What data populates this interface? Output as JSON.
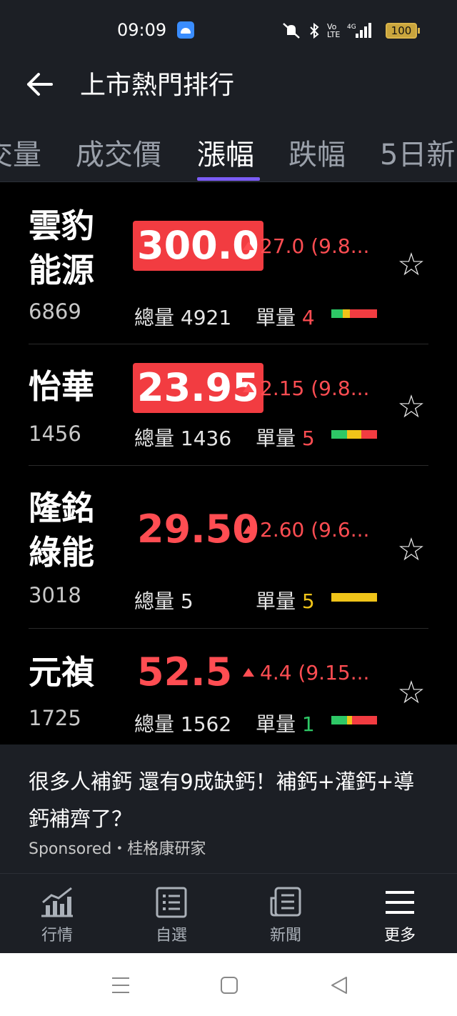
{
  "status_bar": {
    "time": "09:09",
    "network": "4G",
    "volte": "Vo LTE",
    "battery": "100"
  },
  "header": {
    "title": "上市熱門排行"
  },
  "tabs": [
    {
      "label": "成交量"
    },
    {
      "label": "成交價"
    },
    {
      "label": "漲幅"
    },
    {
      "label": "跌幅"
    },
    {
      "label": "5日新"
    }
  ],
  "stocks": [
    {
      "name": "雲豹能源",
      "code": "6869",
      "price": "300.0",
      "change": "27.0 (9.8...",
      "total_volume_label": "總量",
      "total_volume": "4921",
      "unit_volume_label": "單量",
      "unit_volume": "4",
      "bar": [
        {
          "color": "#2ec866",
          "fraction": 0.25
        },
        {
          "color": "#f0c419",
          "fraction": 0.15
        },
        {
          "color": "#f23c41",
          "fraction": 0.6
        }
      ]
    },
    {
      "name": "怡華",
      "code": "1456",
      "price": "23.95",
      "change": "2.15 (9.8...",
      "total_volume_label": "總量",
      "total_volume": "1436",
      "unit_volume_label": "單量",
      "unit_volume": "5",
      "bar": [
        {
          "color": "#2ec866",
          "fraction": 0.35
        },
        {
          "color": "#f0c419",
          "fraction": 0.3
        },
        {
          "color": "#f23c41",
          "fraction": 0.35
        }
      ]
    },
    {
      "name": "隆銘綠能",
      "code": "3018",
      "price": "29.50",
      "change": "2.60 (9.6...",
      "total_volume_label": "總量",
      "total_volume": "5",
      "unit_volume_label": "單量",
      "unit_volume": "5",
      "bar": [
        {
          "color": "#f0c419",
          "fraction": 1.0
        }
      ]
    },
    {
      "name": "元禎",
      "code": "1725",
      "price": "52.5",
      "change": "4.4 (9.15...",
      "total_volume_label": "總量",
      "total_volume": "1562",
      "unit_volume_label": "單量",
      "unit_volume": "1",
      "bar": [
        {
          "color": "#2ec866",
          "fraction": 0.35
        },
        {
          "color": "#f0c419",
          "fraction": 0.1
        },
        {
          "color": "#f23c41",
          "fraction": 0.55
        }
      ]
    }
  ],
  "ad": {
    "text": "很多人補鈣 還有9成缺鈣！補鈣+灌鈣+導鈣補齊了？",
    "sponsor": "Sponsored・桂格康研家"
  },
  "bottom_nav": [
    {
      "label": "行情",
      "icon": "chart-icon"
    },
    {
      "label": "自選",
      "icon": "watchlist-icon"
    },
    {
      "label": "新聞",
      "icon": "news-icon"
    },
    {
      "label": "更多",
      "icon": "menu-icon"
    }
  ]
}
